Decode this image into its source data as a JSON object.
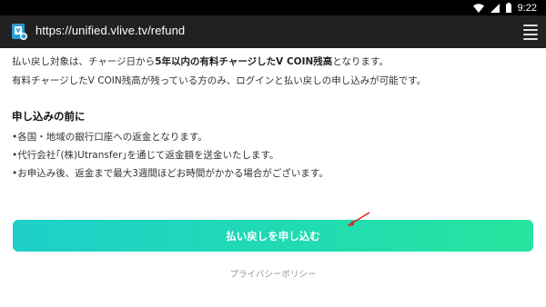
{
  "status_bar": {
    "time": "9:22",
    "icons": [
      "wifi-icon",
      "signal-icon",
      "battery-icon"
    ]
  },
  "browser": {
    "url": "https://unified.vlive.tv/refund",
    "site_icon": "vlive-app-icon",
    "menu_icon": "hamburger-menu-icon"
  },
  "intro": {
    "line1_prefix": "払い戻し対象は、チャージ日から",
    "line1_bold": "5年以内の有料チャージしたV COIN残高",
    "line1_suffix": "となります。",
    "line2": "有料チャージしたV COIN残高が残っている方のみ、ログインと払い戻しの申し込みが可能です。"
  },
  "before_applying": {
    "title": "申し込みの前に",
    "items": [
      "•各国・地域の銀行口座への返金となります。",
      "•代行会社｢(株)Utransfer｣を通じて返金額を送金いたします。",
      "•お申込み後、返金まで最大3週間ほどお時間がかかる場合がございます。"
    ]
  },
  "refund_button": {
    "label": "払い戻しを申し込む"
  },
  "privacy_link": {
    "label": "プライバシーポリシー"
  },
  "colors": {
    "button_gradient_start": "#1fcfc9",
    "button_gradient_end": "#28e49e",
    "annotation_arrow": "#e02020"
  }
}
